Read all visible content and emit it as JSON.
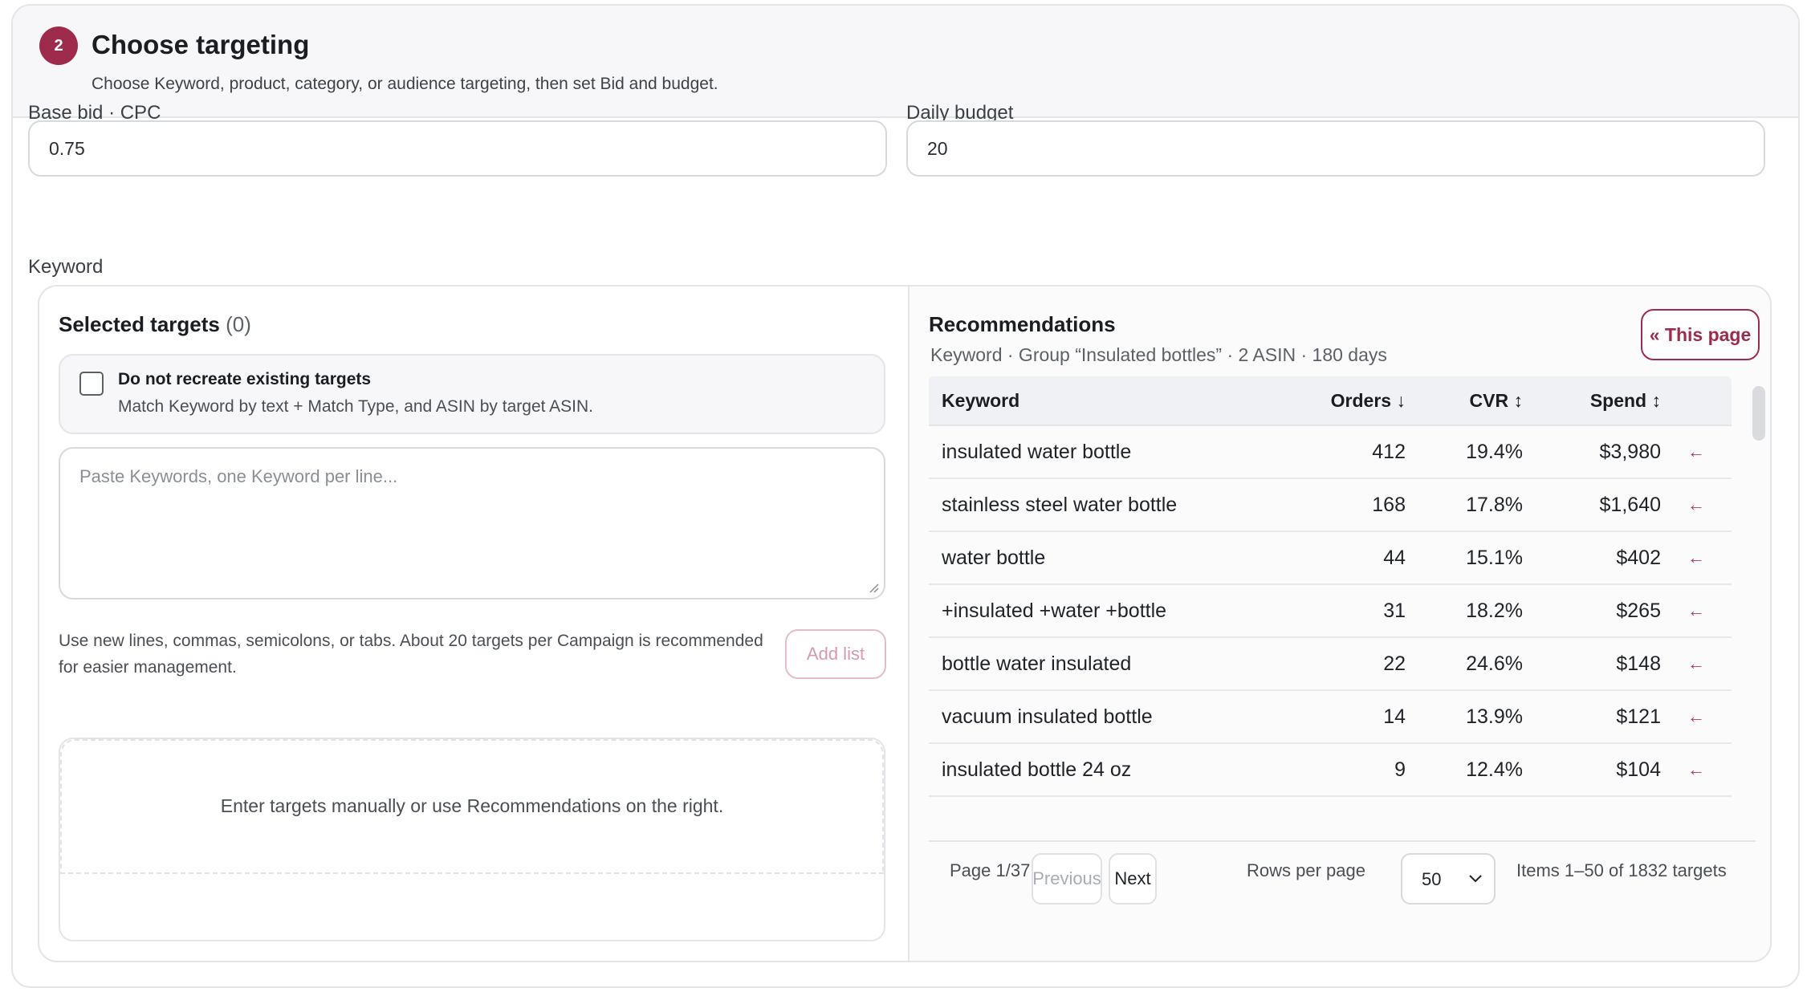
{
  "header": {
    "step_number": "2",
    "title": "Choose targeting",
    "subtitle": "Choose Keyword, product, category, or audience targeting, then set Bid and budget."
  },
  "bid": {
    "label": "Base bid · CPC",
    "value": "0.75"
  },
  "budget": {
    "label": "Daily budget",
    "value": "20"
  },
  "section_label": "Keyword",
  "selected": {
    "title": "Selected targets",
    "count": "(0)",
    "option_title": "Do not recreate existing targets",
    "option_sub": "Match Keyword by text + Match Type, and ASIN by target ASIN.",
    "option_checked": false,
    "textarea_placeholder": "Paste Keywords, one Keyword per line...",
    "help": "Use new lines, commas, semicolons, or tabs. About 20 targets per Campaign is recommended for easier management.",
    "add_label": "Add list",
    "empty_text": "Enter targets manually or use Recommendations on the right."
  },
  "recommendations": {
    "title": "Recommendations",
    "subtitle": "Keyword · Group “Insulated bottles” · 2 ASIN · 180 days",
    "this_page_label": "« This page",
    "columns": {
      "keyword": "Keyword",
      "orders": "Orders ↓",
      "cvr": "CVR ↕",
      "spend": "Spend ↕"
    },
    "rows": [
      {
        "keyword": "insulated water bottle",
        "orders": "412",
        "cvr": "19.4%",
        "spend": "$3,980"
      },
      {
        "keyword": "stainless steel water bottle",
        "orders": "168",
        "cvr": "17.8%",
        "spend": "$1,640"
      },
      {
        "keyword": "water bottle",
        "orders": "44",
        "cvr": "15.1%",
        "spend": "$402"
      },
      {
        "keyword": "+insulated +water +bottle",
        "orders": "31",
        "cvr": "18.2%",
        "spend": "$265"
      },
      {
        "keyword": "bottle water insulated",
        "orders": "22",
        "cvr": "24.6%",
        "spend": "$148"
      },
      {
        "keyword": "vacuum insulated bottle",
        "orders": "14",
        "cvr": "13.9%",
        "spend": "$121"
      },
      {
        "keyword": "insulated bottle 24 oz",
        "orders": "9",
        "cvr": "12.4%",
        "spend": "$104"
      }
    ],
    "add_arrow": "←",
    "pagination": {
      "page_text": "Page 1/37",
      "previous": "Previous",
      "next": "Next",
      "rows_per_page_label": "Rows per page",
      "rows_per_page_value": "50",
      "items_text": "Items 1–50 of 1832 targets"
    }
  },
  "colors": {
    "accent": "#9e2b4b",
    "border": "#e3e5e9"
  }
}
